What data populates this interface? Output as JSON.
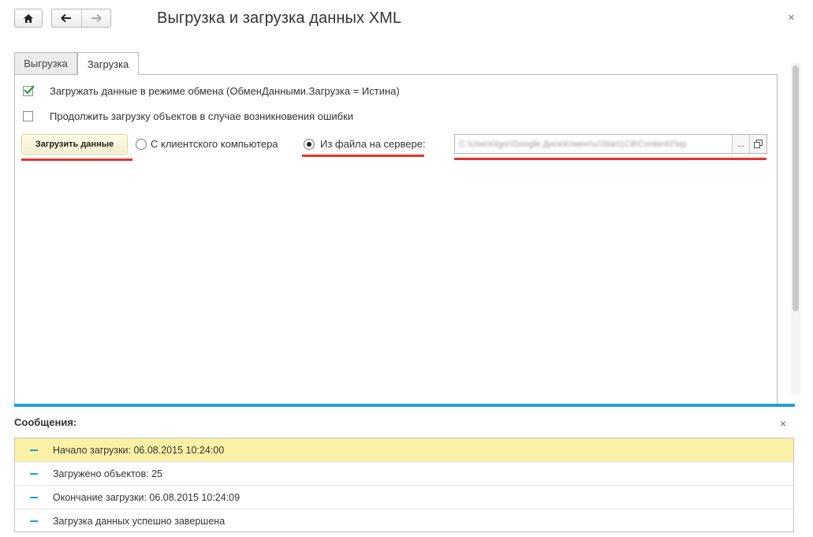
{
  "window": {
    "title": "Выгрузка и загрузка данных XML",
    "close_symbol": "×"
  },
  "toolbar": {
    "home_icon": "home-icon",
    "back_icon": "arrow-left-icon",
    "forward_icon": "arrow-right-icon"
  },
  "tabs": [
    {
      "label": "Выгрузка",
      "active": false
    },
    {
      "label": "Загрузка",
      "active": true
    }
  ],
  "options": {
    "exchange_mode": {
      "label": "Загружать данные в режиме обмена (ОбменДанными.Загрузка = Истина)",
      "checked": true
    },
    "continue_on_error": {
      "label": "Продолжить загрузку объектов в случае возникновения ошибки",
      "checked": false
    }
  },
  "load_button": {
    "label": "Загрузить данные"
  },
  "source": {
    "client": {
      "label": "С клиентского компьютера",
      "selected": false
    },
    "server": {
      "label": "Из файла на сервере:",
      "selected": true
    },
    "path_value": "C:\\Users\\Igor\\Google Диск\\Клиенты\\Start1C8\\Content\\Пер",
    "browse_label": "...",
    "open_icon": "open-copy-icon"
  },
  "messages": {
    "title": "Сообщения:",
    "close_symbol": "×",
    "items": [
      {
        "text": "Начало загрузки: 06.08.2015 10:24:00",
        "selected": true
      },
      {
        "text": "Загружено объектов: 25",
        "selected": false
      },
      {
        "text": "Окончание загрузки: 06.08.2015 10:24:09",
        "selected": false
      },
      {
        "text": "Загрузка данных успешно завершена",
        "selected": false
      }
    ]
  },
  "colors": {
    "accent_blue": "#1e9fdc",
    "highlight_yellow": "#fbf1a6",
    "underline_red": "#e3352b",
    "checkmark_green": "#2f9b3a"
  }
}
